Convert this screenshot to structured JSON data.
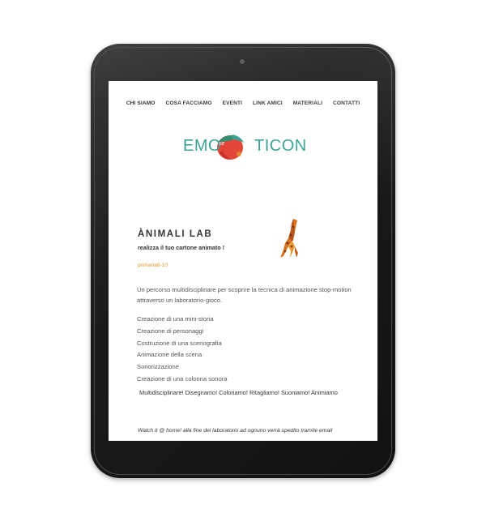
{
  "nav": {
    "items": [
      "CHI SIAMO",
      "COSA FACCIAMO",
      "EVENTI",
      "LINK AMICI",
      "MATERIALI",
      "CONTATTI"
    ]
  },
  "logo": {
    "left": "EMO",
    "right": "TICON",
    "small": "se"
  },
  "page": {
    "title": "ÀNIMALI LAB",
    "subtitle": "realizza il tuo cartone animato !",
    "tag": "primaria6-10",
    "intro": "Un percorso multidisciplinare per scoprire la tecnica di animazione stop-motion attraverso un laboratorio-gioco.",
    "list": [
      "Creazione di una mini-storia",
      "Creazione di personaggi",
      "Costruzione di una scenografia",
      "Animazione della scena",
      "Sonorizzazione",
      "Creazione di una colonna sonora"
    ],
    "motto": "Multidisciplinare! Disegnamo! Coloriamo! Ritagliamo! Suoniamo! Animiamo",
    "footer": "Watch it @ home! alla fine del laboratorio ad ognuno verrà spedito tramite email"
  },
  "colors": {
    "logo_teal": "#3aa394",
    "tag_orange": "#e8952b"
  }
}
